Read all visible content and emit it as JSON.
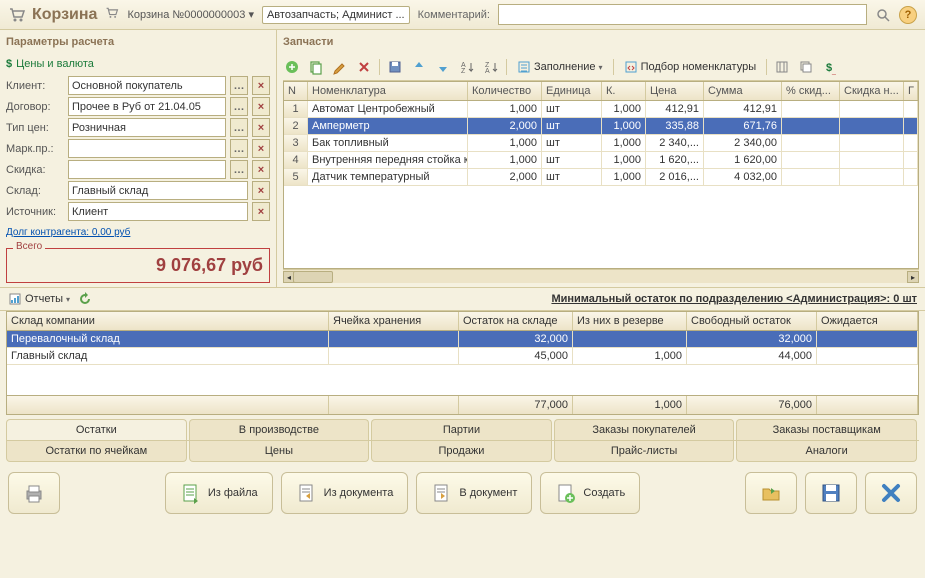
{
  "header": {
    "title": "Корзина",
    "doc_number": "Корзина №0000000003",
    "filter": "Автозапчасть; Админист ...",
    "comment_label": "Комментарий:",
    "comment_value": ""
  },
  "left": {
    "section_title": "Параметры расчета",
    "prices_link": "Цены и валюта",
    "fields": {
      "client": {
        "label": "Клиент:",
        "value": "Основной покупатель"
      },
      "contract": {
        "label": "Договор:",
        "value": "Прочее в Руб от 21.04.05"
      },
      "price_type": {
        "label": "Тип цен:",
        "value": "Розничная"
      },
      "marketing": {
        "label": "Марк.пр.:",
        "value": ""
      },
      "discount": {
        "label": "Скидка:",
        "value": ""
      },
      "warehouse": {
        "label": "Склад:",
        "value": "Главный склад"
      },
      "source": {
        "label": "Источник:",
        "value": "Клиент"
      }
    },
    "debt_link": "Долг контрагента: 0,00 руб",
    "total_legend": "Всего",
    "total_value": "9 076,67 руб"
  },
  "parts": {
    "section_title": "Запчасти",
    "toolbar": {
      "fill": "Заполнение",
      "pick": "Подбор номенклатуры"
    },
    "columns": [
      "N",
      "Номенклатура",
      "Количество",
      "Единица",
      "К.",
      "Цена",
      "Сумма",
      "% скид...",
      "Скидка н...",
      "Г"
    ],
    "rows": [
      {
        "n": "1",
        "name": "Автомат Центробежный",
        "qty": "1,000",
        "unit": "шт",
        "k": "1,000",
        "price": "412,91",
        "sum": "412,91"
      },
      {
        "n": "2",
        "name": "Амперметр",
        "qty": "2,000",
        "unit": "шт",
        "k": "1,000",
        "price": "335,88",
        "sum": "671,76",
        "selected": true
      },
      {
        "n": "3",
        "name": "Бак топливный",
        "qty": "1,000",
        "unit": "шт",
        "k": "1,000",
        "price": "2 340,...",
        "sum": "2 340,00"
      },
      {
        "n": "4",
        "name": "Внутренняя передняя стойка к...",
        "qty": "1,000",
        "unit": "шт",
        "k": "1,000",
        "price": "1 620,...",
        "sum": "1 620,00"
      },
      {
        "n": "5",
        "name": "Датчик температурный",
        "qty": "2,000",
        "unit": "шт",
        "k": "1,000",
        "price": "2 016,...",
        "sum": "4 032,00"
      }
    ]
  },
  "reports": {
    "button": "Отчеты",
    "min_stock": "Минимальный остаток по подразделению <Администрация>: 0 шт"
  },
  "stock": {
    "columns": [
      "Склад компании",
      "Ячейка хранения",
      "Остаток на складе",
      "Из них в резерве",
      "Свободный остаток",
      "Ожидается"
    ],
    "rows": [
      {
        "name": "Перевалочный склад",
        "cell": "",
        "stock": "32,000",
        "reserve": "",
        "free": "32,000",
        "expected": "",
        "selected": true
      },
      {
        "name": "Главный склад",
        "cell": "",
        "stock": "45,000",
        "reserve": "1,000",
        "free": "44,000",
        "expected": ""
      }
    ],
    "totals": {
      "stock": "77,000",
      "reserve": "1,000",
      "free": "76,000"
    }
  },
  "tabs1": [
    "Остатки",
    "В производстве",
    "Партии",
    "Заказы покупателей",
    "Заказы поставщикам"
  ],
  "tabs1_active": 0,
  "tabs2": [
    "Остатки по ячейкам",
    "Цены",
    "Продажи",
    "Прайс-листы",
    "Аналоги"
  ],
  "bottom": {
    "from_file": "Из файла",
    "from_doc": "Из документа",
    "to_doc": "В документ",
    "create": "Создать"
  }
}
